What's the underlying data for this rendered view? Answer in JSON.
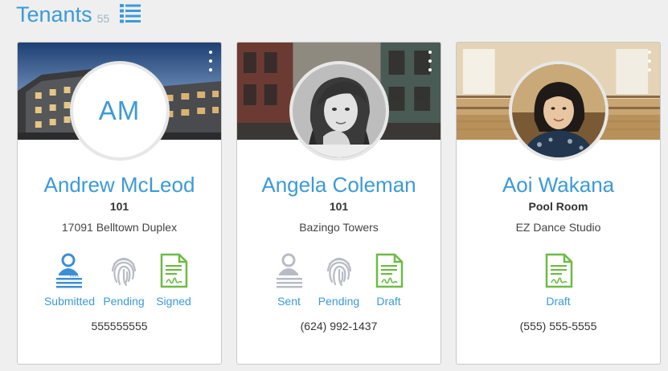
{
  "header": {
    "title": "Tenants",
    "count": "55"
  },
  "tenants": [
    {
      "initials": "AM",
      "name": "Andrew McLeod",
      "unit": "101",
      "property": "17091 Belltown Duplex",
      "statuses": [
        {
          "icon": "application-icon",
          "label": "Submitted",
          "state": "active"
        },
        {
          "icon": "fingerprint-icon",
          "label": "Pending",
          "state": "inactive"
        },
        {
          "icon": "lease-sign-icon",
          "label": "Signed",
          "state": "active"
        }
      ],
      "phone": "555555555"
    },
    {
      "name": "Angela Coleman",
      "unit": "101",
      "property": "Bazingo Towers",
      "statuses": [
        {
          "icon": "application-icon",
          "label": "Sent",
          "state": "inactive"
        },
        {
          "icon": "fingerprint-icon",
          "label": "Pending",
          "state": "inactive"
        },
        {
          "icon": "lease-sign-icon",
          "label": "Draft",
          "state": "active"
        }
      ],
      "phone": "(624) 992-1437"
    },
    {
      "name": "Aoi Wakana",
      "unit": "Pool Room",
      "property": "EZ Dance Studio",
      "statuses": [
        {
          "icon": "lease-sign-icon",
          "label": "Draft",
          "state": "active"
        }
      ],
      "phone": "(555) 555-5555"
    }
  ],
  "colors": {
    "accent": "#3b9ad9",
    "active_blue": "#3b8fd6",
    "inactive_gray": "#b7bcc4",
    "sign_green": "#6dbb45"
  }
}
